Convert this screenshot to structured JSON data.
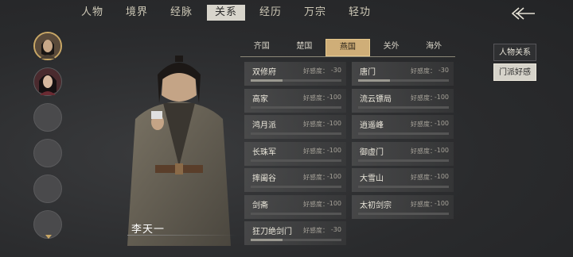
{
  "nav": {
    "tabs": [
      "人物",
      "境界",
      "经脉",
      "关系",
      "经历",
      "万宗",
      "轻功"
    ],
    "active_index": 3
  },
  "character": {
    "name": "李天一"
  },
  "regions": {
    "tabs": [
      "齐国",
      "楚国",
      "燕国",
      "关外",
      "海外"
    ],
    "active_index": 2
  },
  "affinity_label": "好感度：",
  "factions": [
    {
      "name": "双修府",
      "value": "-30",
      "fill": 0.35
    },
    {
      "name": "唐门",
      "value": "-30",
      "fill": 0.35
    },
    {
      "name": "高家",
      "value": "-100",
      "fill": 0.0
    },
    {
      "name": "流云镖局",
      "value": "-100",
      "fill": 0.0
    },
    {
      "name": "鸿月派",
      "value": "-100",
      "fill": 0.0
    },
    {
      "name": "逍遥峰",
      "value": "-100",
      "fill": 0.0
    },
    {
      "name": "长珠军",
      "value": "-100",
      "fill": 0.0
    },
    {
      "name": "御虚门",
      "value": "-100",
      "fill": 0.0
    },
    {
      "name": "摔阖谷",
      "value": "-100",
      "fill": 0.0
    },
    {
      "name": "大雪山",
      "value": "-100",
      "fill": 0.0
    },
    {
      "name": "剑斋",
      "value": "-100",
      "fill": 0.0
    },
    {
      "name": "太初剑宗",
      "value": "-100",
      "fill": 0.0
    },
    {
      "name": "狂刀绝剑门",
      "value": "-30",
      "fill": 0.35
    }
  ],
  "side_buttons": {
    "relations": "人物关系",
    "sect_affinity": "门派好感"
  },
  "colors": {
    "accent_gold": "#cfae78",
    "active_tab": "#d8d5cc",
    "background": "#2a2b2d"
  }
}
